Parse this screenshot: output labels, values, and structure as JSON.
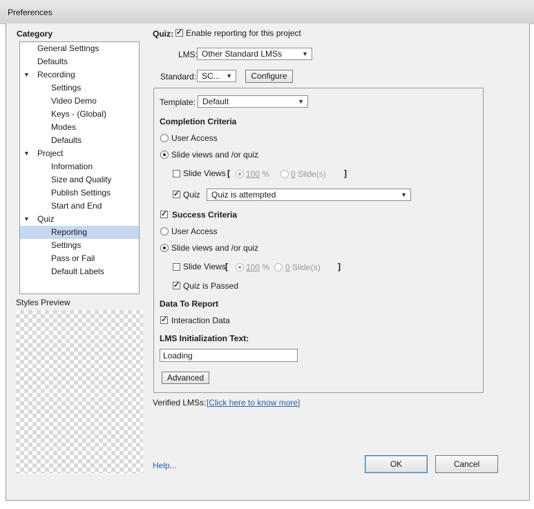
{
  "window": {
    "title": "Preferences"
  },
  "category": {
    "label": "Category",
    "items": [
      {
        "label": "General Settings",
        "level": 0,
        "expandable": false,
        "selected": false
      },
      {
        "label": "Defaults",
        "level": 0,
        "expandable": false,
        "selected": false
      },
      {
        "label": "Recording",
        "level": 0,
        "expandable": true,
        "selected": false
      },
      {
        "label": "Settings",
        "level": 1,
        "expandable": false,
        "selected": false
      },
      {
        "label": "Video Demo",
        "level": 1,
        "expandable": false,
        "selected": false
      },
      {
        "label": "Keys - (Global)",
        "level": 1,
        "expandable": false,
        "selected": false
      },
      {
        "label": "Modes",
        "level": 1,
        "expandable": false,
        "selected": false
      },
      {
        "label": "Defaults",
        "level": 1,
        "expandable": false,
        "selected": false
      },
      {
        "label": "Project",
        "level": 0,
        "expandable": true,
        "selected": false
      },
      {
        "label": "Information",
        "level": 1,
        "expandable": false,
        "selected": false
      },
      {
        "label": "Size and Quality",
        "level": 1,
        "expandable": false,
        "selected": false
      },
      {
        "label": "Publish Settings",
        "level": 1,
        "expandable": false,
        "selected": false
      },
      {
        "label": "Start and End",
        "level": 1,
        "expandable": false,
        "selected": false
      },
      {
        "label": "Quiz",
        "level": 0,
        "expandable": true,
        "selected": false
      },
      {
        "label": "Reporting",
        "level": 1,
        "expandable": false,
        "selected": true
      },
      {
        "label": "Settings",
        "level": 1,
        "expandable": false,
        "selected": false
      },
      {
        "label": "Pass or Fail",
        "level": 1,
        "expandable": false,
        "selected": false
      },
      {
        "label": "Default Labels",
        "level": 1,
        "expandable": false,
        "selected": false
      }
    ]
  },
  "styles_preview": {
    "label": "Styles Preview"
  },
  "reporting": {
    "quiz_label": "Quiz:",
    "enable_label": "Enable reporting for this project",
    "enable_checked": true,
    "lms_label": "LMS:",
    "lms_value": "Other Standard LMSs",
    "standard_label": "Standard:",
    "standard_value": "SC...",
    "configure_label": "Configure",
    "template_label": "Template:",
    "template_value": "Default",
    "completion": {
      "heading": "Completion Criteria",
      "user_access": "User Access",
      "slide_views_quiz": "Slide views and /or quiz",
      "slide_views_label": "Slide Views",
      "open_bracket": "[",
      "close_bracket": "]",
      "percent_value": "100",
      "percent_unit": " %",
      "slides_value": "0",
      "slides_unit": " Slide(s)",
      "quiz_label": "Quiz",
      "quiz_value": "Quiz is attempted"
    },
    "success": {
      "heading": "Success Criteria",
      "user_access": "User Access",
      "slide_views_quiz": "Slide views and /or quiz",
      "slide_views_label": "Slide Views",
      "open_bracket": "[",
      "close_bracket": "]",
      "percent_value": "100",
      "percent_unit": " %",
      "slides_value": "0",
      "slides_unit": " Slide(s)",
      "quiz_passed_label": "Quiz is Passed"
    },
    "data_to_report": {
      "heading": "Data To Report",
      "interaction_label": "Interaction Data"
    },
    "lms_init": {
      "heading": "LMS Initialization Text:",
      "value": "Loading"
    },
    "advanced_label": "Advanced",
    "verified_label": "Verified LMSs:",
    "verified_link": "[Click here to know more]"
  },
  "footer": {
    "help": "Help...",
    "ok": "OK",
    "cancel": "Cancel"
  }
}
